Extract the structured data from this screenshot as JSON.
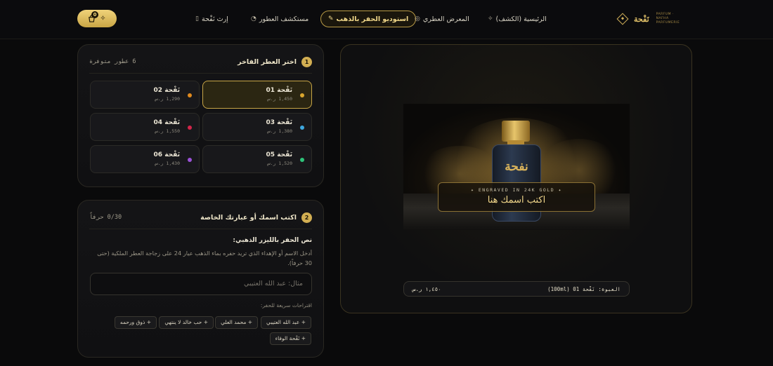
{
  "header": {
    "cart_count": "0",
    "nav": [
      {
        "label": "إرث نَفْحة",
        "icon": "book-icon"
      },
      {
        "label": "مستكشف العطور",
        "icon": "palette-icon"
      },
      {
        "label": "استوديو الحفر بالذهب",
        "icon": "feather-icon"
      },
      {
        "label": "المعرض العطري",
        "icon": "compass-icon"
      },
      {
        "label": "الرئيسية (الكشف)",
        "icon": "sparkle-icon"
      }
    ],
    "brand_name": "نَفْحة",
    "brand_sub": "PARFUM · NAFHA PARFUMERIE",
    "accent": "#d2ae52"
  },
  "step1": {
    "number": "1",
    "title": "اختر العطر الفاخر",
    "count": "6 عطور متوفرة",
    "fragrances": [
      {
        "name": "نَفْحة 01",
        "price": "1,450 ر.س",
        "color": "#d9a62e",
        "selected": true
      },
      {
        "name": "نَفْحة 02",
        "price": "1,290 ر.س",
        "color": "#e08a1e",
        "selected": false
      },
      {
        "name": "نَفْحة 03",
        "price": "1,380 ر.س",
        "color": "#3ea8e0",
        "selected": false
      },
      {
        "name": "نَفْحة 04",
        "price": "1,550 ر.س",
        "color": "#d2264a",
        "selected": false
      },
      {
        "name": "نَفْحة 05",
        "price": "1,520 ر.س",
        "color": "#2ec47a",
        "selected": false
      },
      {
        "name": "نَفْحة 06",
        "price": "1,430 ر.س",
        "color": "#9b52d8",
        "selected": false
      }
    ]
  },
  "step2": {
    "number": "2",
    "title": "اكتب اسمك أو عبارتك الخاصة",
    "char_count": "0/30 حرفاً",
    "field_label": "نص الحفر بالليزر الذهبي:",
    "help": "أدخل الاسم أو الإهداء الذي تريد حفره بماء الذهب عيار 24 على زجاجة العطر الملكية (حتى 30 حرفاً).",
    "placeholder": "مثال: عبد الله العتيبي",
    "suggestions_label": "اقتراحات سريعة للحفر:",
    "suggestions": [
      "+ عبد الله العتيبي",
      "+ محمد العلي",
      "+ حب خالد لا ينتهي",
      "+ ذوق ورحمه",
      "+ نَفْحة الوفاء"
    ]
  },
  "preview": {
    "bottle_logo": "نفحة",
    "engrave_tag": "✦ ENGRAVED IN 24K GOLD ✦",
    "engrave_text": "اكتب اسمك هنا",
    "summary_left": "العبوة: نَفْحة 01 (100ml)",
    "summary_right": "١,٤٥٠ ر.س"
  }
}
